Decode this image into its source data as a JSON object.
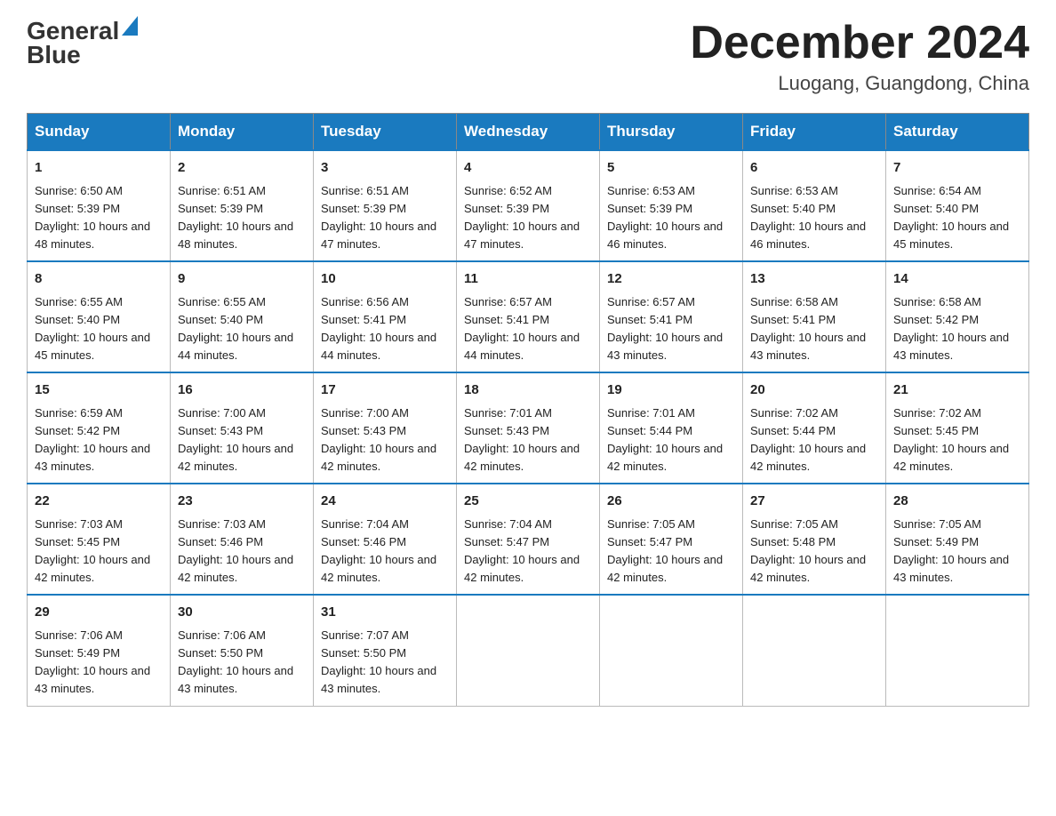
{
  "logo": {
    "text_general": "General",
    "text_blue": "Blue"
  },
  "title": "December 2024",
  "location": "Luogang, Guangdong, China",
  "days_of_week": [
    "Sunday",
    "Monday",
    "Tuesday",
    "Wednesday",
    "Thursday",
    "Friday",
    "Saturday"
  ],
  "weeks": [
    [
      {
        "day": 1,
        "sunrise": "6:50 AM",
        "sunset": "5:39 PM",
        "daylight": "10 hours and 48 minutes."
      },
      {
        "day": 2,
        "sunrise": "6:51 AM",
        "sunset": "5:39 PM",
        "daylight": "10 hours and 48 minutes."
      },
      {
        "day": 3,
        "sunrise": "6:51 AM",
        "sunset": "5:39 PM",
        "daylight": "10 hours and 47 minutes."
      },
      {
        "day": 4,
        "sunrise": "6:52 AM",
        "sunset": "5:39 PM",
        "daylight": "10 hours and 47 minutes."
      },
      {
        "day": 5,
        "sunrise": "6:53 AM",
        "sunset": "5:39 PM",
        "daylight": "10 hours and 46 minutes."
      },
      {
        "day": 6,
        "sunrise": "6:53 AM",
        "sunset": "5:40 PM",
        "daylight": "10 hours and 46 minutes."
      },
      {
        "day": 7,
        "sunrise": "6:54 AM",
        "sunset": "5:40 PM",
        "daylight": "10 hours and 45 minutes."
      }
    ],
    [
      {
        "day": 8,
        "sunrise": "6:55 AM",
        "sunset": "5:40 PM",
        "daylight": "10 hours and 45 minutes."
      },
      {
        "day": 9,
        "sunrise": "6:55 AM",
        "sunset": "5:40 PM",
        "daylight": "10 hours and 44 minutes."
      },
      {
        "day": 10,
        "sunrise": "6:56 AM",
        "sunset": "5:41 PM",
        "daylight": "10 hours and 44 minutes."
      },
      {
        "day": 11,
        "sunrise": "6:57 AM",
        "sunset": "5:41 PM",
        "daylight": "10 hours and 44 minutes."
      },
      {
        "day": 12,
        "sunrise": "6:57 AM",
        "sunset": "5:41 PM",
        "daylight": "10 hours and 43 minutes."
      },
      {
        "day": 13,
        "sunrise": "6:58 AM",
        "sunset": "5:41 PM",
        "daylight": "10 hours and 43 minutes."
      },
      {
        "day": 14,
        "sunrise": "6:58 AM",
        "sunset": "5:42 PM",
        "daylight": "10 hours and 43 minutes."
      }
    ],
    [
      {
        "day": 15,
        "sunrise": "6:59 AM",
        "sunset": "5:42 PM",
        "daylight": "10 hours and 43 minutes."
      },
      {
        "day": 16,
        "sunrise": "7:00 AM",
        "sunset": "5:43 PM",
        "daylight": "10 hours and 42 minutes."
      },
      {
        "day": 17,
        "sunrise": "7:00 AM",
        "sunset": "5:43 PM",
        "daylight": "10 hours and 42 minutes."
      },
      {
        "day": 18,
        "sunrise": "7:01 AM",
        "sunset": "5:43 PM",
        "daylight": "10 hours and 42 minutes."
      },
      {
        "day": 19,
        "sunrise": "7:01 AM",
        "sunset": "5:44 PM",
        "daylight": "10 hours and 42 minutes."
      },
      {
        "day": 20,
        "sunrise": "7:02 AM",
        "sunset": "5:44 PM",
        "daylight": "10 hours and 42 minutes."
      },
      {
        "day": 21,
        "sunrise": "7:02 AM",
        "sunset": "5:45 PM",
        "daylight": "10 hours and 42 minutes."
      }
    ],
    [
      {
        "day": 22,
        "sunrise": "7:03 AM",
        "sunset": "5:45 PM",
        "daylight": "10 hours and 42 minutes."
      },
      {
        "day": 23,
        "sunrise": "7:03 AM",
        "sunset": "5:46 PM",
        "daylight": "10 hours and 42 minutes."
      },
      {
        "day": 24,
        "sunrise": "7:04 AM",
        "sunset": "5:46 PM",
        "daylight": "10 hours and 42 minutes."
      },
      {
        "day": 25,
        "sunrise": "7:04 AM",
        "sunset": "5:47 PM",
        "daylight": "10 hours and 42 minutes."
      },
      {
        "day": 26,
        "sunrise": "7:05 AM",
        "sunset": "5:47 PM",
        "daylight": "10 hours and 42 minutes."
      },
      {
        "day": 27,
        "sunrise": "7:05 AM",
        "sunset": "5:48 PM",
        "daylight": "10 hours and 42 minutes."
      },
      {
        "day": 28,
        "sunrise": "7:05 AM",
        "sunset": "5:49 PM",
        "daylight": "10 hours and 43 minutes."
      }
    ],
    [
      {
        "day": 29,
        "sunrise": "7:06 AM",
        "sunset": "5:49 PM",
        "daylight": "10 hours and 43 minutes."
      },
      {
        "day": 30,
        "sunrise": "7:06 AM",
        "sunset": "5:50 PM",
        "daylight": "10 hours and 43 minutes."
      },
      {
        "day": 31,
        "sunrise": "7:07 AM",
        "sunset": "5:50 PM",
        "daylight": "10 hours and 43 minutes."
      },
      null,
      null,
      null,
      null
    ]
  ]
}
